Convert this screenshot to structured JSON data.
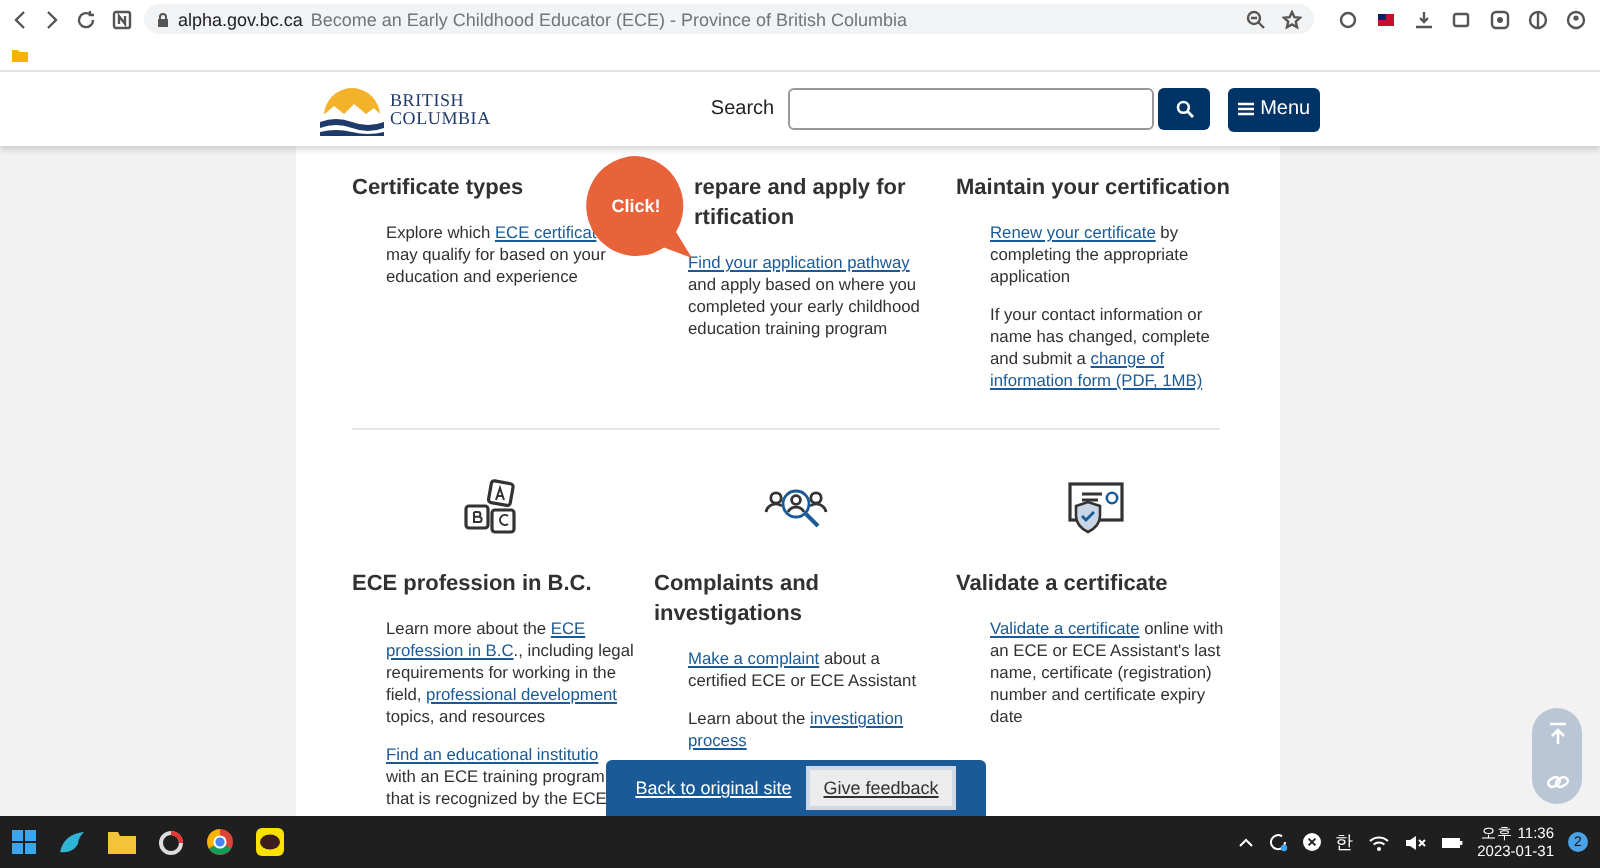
{
  "browser": {
    "host": "alpha.gov.bc.ca",
    "page_title": "Become an Early Childhood Educator (ECE) - Province of British Columbia"
  },
  "header": {
    "logo_lines": [
      "BRITISH",
      "COLUMBIA"
    ],
    "search_label": "Search",
    "menu_label": "Menu"
  },
  "callout": {
    "text": "Click!"
  },
  "rows": [
    {
      "columns": [
        {
          "heading_lines": [
            "Certificate types"
          ],
          "items": [
            {
              "lines": [
                [
                  {
                    "kind": "text",
                    "text": "Explore which "
                  },
                  {
                    "kind": "link",
                    "text": "ECE certificat"
                  }
                ],
                [
                  {
                    "kind": "text",
                    "text": "may qualify for based on your"
                  }
                ],
                [
                  {
                    "kind": "text",
                    "text": "education and experience"
                  }
                ]
              ]
            }
          ]
        },
        {
          "heading_lines": [
            "repare and apply for",
            "rtification"
          ],
          "items": [
            {
              "lines": [
                [
                  {
                    "kind": "link",
                    "text": "Find your application pathway"
                  }
                ],
                [
                  {
                    "kind": "text",
                    "text": "and apply based on where you"
                  }
                ],
                [
                  {
                    "kind": "text",
                    "text": "completed your early childhood"
                  }
                ],
                [
                  {
                    "kind": "text",
                    "text": "education training program"
                  }
                ]
              ]
            }
          ]
        },
        {
          "heading_lines": [
            "Maintain your certification"
          ],
          "items": [
            {
              "lines": [
                [
                  {
                    "kind": "link",
                    "text": "Renew your certificate"
                  },
                  {
                    "kind": "text",
                    "text": " by"
                  }
                ],
                [
                  {
                    "kind": "text",
                    "text": "completing the appropriate"
                  }
                ],
                [
                  {
                    "kind": "text",
                    "text": "application"
                  }
                ]
              ]
            },
            {
              "lines": [
                [
                  {
                    "kind": "text",
                    "text": "If your contact information or"
                  }
                ],
                [
                  {
                    "kind": "text",
                    "text": "name has changed, complete"
                  }
                ],
                [
                  {
                    "kind": "text",
                    "text": "and submit a "
                  },
                  {
                    "kind": "link",
                    "text": "change of"
                  }
                ],
                [
                  {
                    "kind": "link",
                    "text": "information form (PDF, 1MB)"
                  }
                ]
              ]
            }
          ]
        }
      ]
    },
    {
      "columns": [
        {
          "heading_lines": [
            "ECE profession in B.C."
          ],
          "items": [
            {
              "lines": [
                [
                  {
                    "kind": "text",
                    "text": "Learn more about the "
                  },
                  {
                    "kind": "link",
                    "text": "ECE"
                  }
                ],
                [
                  {
                    "kind": "link",
                    "text": "profession in B.C"
                  },
                  {
                    "kind": "text",
                    "text": "., including legal"
                  }
                ],
                [
                  {
                    "kind": "text",
                    "text": "requirements for working in the"
                  }
                ],
                [
                  {
                    "kind": "text",
                    "text": "field, "
                  },
                  {
                    "kind": "link",
                    "text": "professional development"
                  }
                ],
                [
                  {
                    "kind": "text",
                    "text": "topics, and resources"
                  }
                ]
              ]
            },
            {
              "lines": [
                [
                  {
                    "kind": "link",
                    "text": "Find an educational institutio"
                  }
                ],
                [
                  {
                    "kind": "text",
                    "text": "with an ECE training program"
                  }
                ],
                [
                  {
                    "kind": "text",
                    "text": "that is recognized by the ECE"
                  }
                ]
              ]
            }
          ]
        },
        {
          "heading_lines": [
            "Complaints and",
            "investigations"
          ],
          "items": [
            {
              "lines": [
                [
                  {
                    "kind": "link",
                    "text": "Make a complaint"
                  },
                  {
                    "kind": "text",
                    "text": " about a"
                  }
                ],
                [
                  {
                    "kind": "text",
                    "text": "certified ECE or ECE Assistant"
                  }
                ]
              ]
            },
            {
              "lines": [
                [
                  {
                    "kind": "text",
                    "text": "Learn about the "
                  },
                  {
                    "kind": "link",
                    "text": "investigation"
                  }
                ],
                [
                  {
                    "kind": "link",
                    "text": "process"
                  }
                ]
              ]
            }
          ]
        },
        {
          "heading_lines": [
            "Validate a certificate"
          ],
          "items": [
            {
              "lines": [
                [
                  {
                    "kind": "link",
                    "text": "Validate a certificate"
                  },
                  {
                    "kind": "text",
                    "text": " online with"
                  }
                ],
                [
                  {
                    "kind": "text",
                    "text": "an ECE or ECE Assistant's last"
                  }
                ],
                [
                  {
                    "kind": "text",
                    "text": "name, certificate (registration)"
                  }
                ],
                [
                  {
                    "kind": "text",
                    "text": "number and certificate expiry"
                  }
                ],
                [
                  {
                    "kind": "text",
                    "text": "date"
                  }
                ]
              ]
            }
          ]
        }
      ]
    }
  ],
  "feedback_bar": [
    {
      "kind": "link",
      "label": "Back to original site"
    },
    {
      "kind": "button",
      "label": "Give feedback"
    }
  ],
  "taskbar": {
    "ime": "한",
    "time": "오후 11:36",
    "date": "2023-01-31",
    "notifications": "2"
  }
}
